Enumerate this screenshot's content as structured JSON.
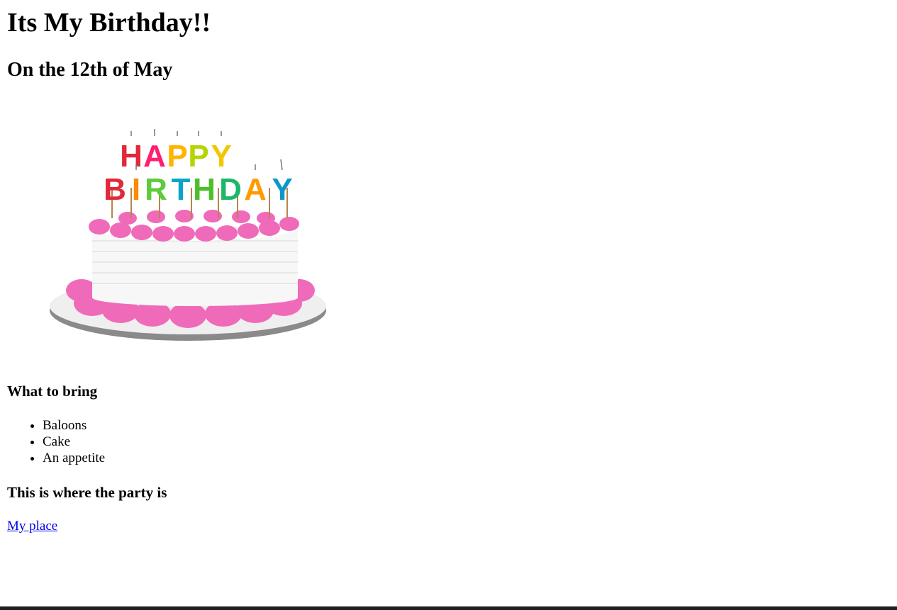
{
  "header": {
    "title": "Its My Birthday!!",
    "subtitle": "On the 12th of May"
  },
  "image": {
    "description": "birthday-cake-image",
    "candle_line_1": "HAPPY",
    "candle_line_2": "BIRTHDAY"
  },
  "bring": {
    "heading": "What to bring",
    "items": [
      "Baloons",
      "Cake",
      "An appetite"
    ]
  },
  "party": {
    "heading": "This is where the party is",
    "link_text": "My place"
  },
  "colors": {
    "link": "#0000ee",
    "frosting": "#f06aba",
    "cake": "#f5f5f5",
    "plate": "#d9d9d9"
  }
}
